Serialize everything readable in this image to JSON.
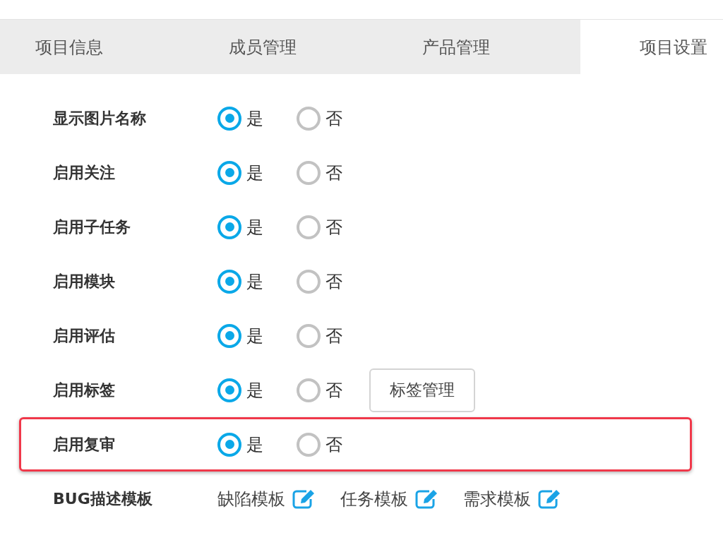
{
  "tabs": [
    {
      "label": "项目信息",
      "selected": false
    },
    {
      "label": "成员管理",
      "selected": false
    },
    {
      "label": "产品管理",
      "selected": false
    },
    {
      "label": "项目设置",
      "selected": true
    }
  ],
  "settings": [
    {
      "label": "显示图片名称",
      "kind": "radio",
      "highlighted": false,
      "options": [
        {
          "label": "是",
          "selected": true
        },
        {
          "label": "否",
          "selected": false
        }
      ]
    },
    {
      "label": "启用关注",
      "kind": "radio",
      "highlighted": false,
      "options": [
        {
          "label": "是",
          "selected": true
        },
        {
          "label": "否",
          "selected": false
        }
      ]
    },
    {
      "label": "启用子任务",
      "kind": "radio",
      "highlighted": false,
      "options": [
        {
          "label": "是",
          "selected": true
        },
        {
          "label": "否",
          "selected": false
        }
      ]
    },
    {
      "label": "启用模块",
      "kind": "radio",
      "highlighted": false,
      "options": [
        {
          "label": "是",
          "selected": true
        },
        {
          "label": "否",
          "selected": false
        }
      ]
    },
    {
      "label": "启用评估",
      "kind": "radio",
      "highlighted": false,
      "options": [
        {
          "label": "是",
          "selected": true
        },
        {
          "label": "否",
          "selected": false
        }
      ]
    },
    {
      "label": "启用标签",
      "kind": "radio",
      "highlighted": false,
      "button": "标签管理",
      "options": [
        {
          "label": "是",
          "selected": true
        },
        {
          "label": "否",
          "selected": false
        }
      ]
    },
    {
      "label": "启用复审",
      "kind": "radio",
      "highlighted": true,
      "options": [
        {
          "label": "是",
          "selected": true
        },
        {
          "label": "否",
          "selected": false
        }
      ]
    },
    {
      "label": "BUG描述模板",
      "kind": "templates",
      "highlighted": false,
      "templates": [
        "缺陷模板",
        "任务模板",
        "需求模板"
      ]
    }
  ]
}
